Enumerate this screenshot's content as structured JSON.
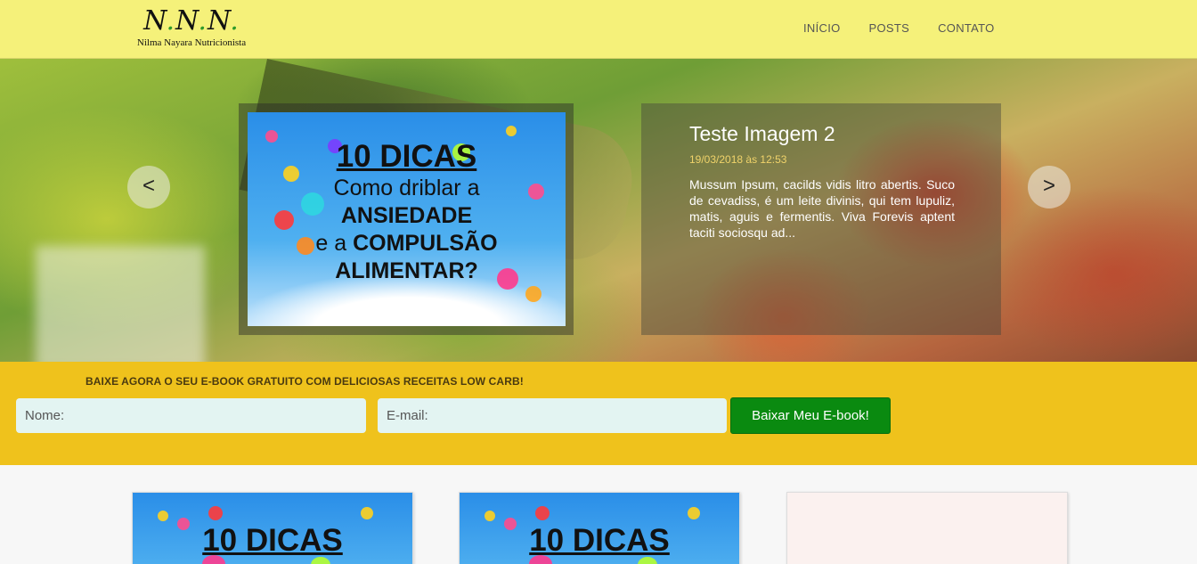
{
  "header": {
    "logo_mark_parts": [
      "N",
      ".",
      "N",
      ".",
      "N",
      "."
    ],
    "logo_subtitle": "Nilma Nayara Nutricionista",
    "nav": [
      "INÍCIO",
      "POSTS",
      "CONTATO"
    ]
  },
  "slider": {
    "prev_label": "<",
    "next_label": ">",
    "image_text": {
      "line1": "10 DICAS",
      "line2": "Como driblar a",
      "line3": "ANSIEDADE",
      "line4_pre": "e a ",
      "line4_bold": "COMPULSÃO",
      "line5": "ALIMENTAR?"
    },
    "caption": {
      "title": "Teste Imagem 2",
      "date": "19/03/2018 às 12:53",
      "text": "Mussum Ipsum, cacilds vidis litro abertis. Suco de cevadiss, é um leite divinis, qui tem lupuliz, matis, aguis e fermentis. Viva Forevis aptent taciti sociosqu ad..."
    }
  },
  "ebook": {
    "title": "BAIXE AGORA O SEU E-BOOK GRATUITO COM DELICIOSAS RECEITAS LOW CARB!",
    "name_placeholder": "Nome:",
    "email_placeholder": "E-mail:",
    "button_label": "Baixar Meu E-book!"
  },
  "posts": [
    {
      "thumb_title": "10 DICAS"
    },
    {
      "thumb_title": "10 DICAS"
    },
    {
      "thumb_title": ""
    }
  ],
  "colors": {
    "header_bg": "#f5f17a",
    "ebook_band": "#efc21c",
    "button_green": "#0a8a10",
    "date_gold": "#f0d36a",
    "input_bg": "#e3f4f2"
  }
}
